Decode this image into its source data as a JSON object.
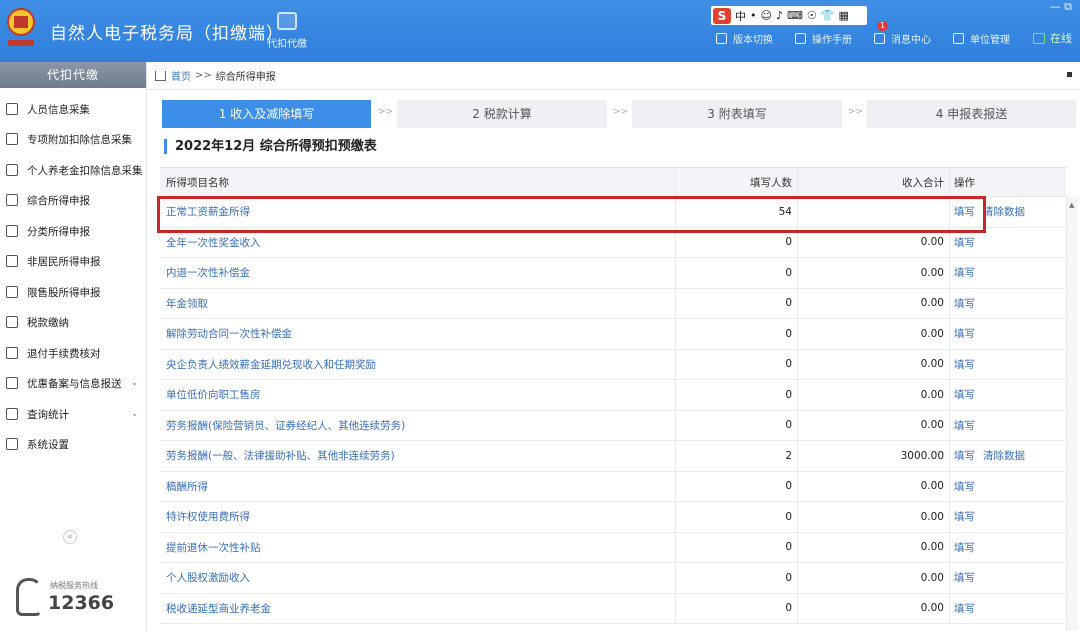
{
  "header": {
    "title": "自然人电子税务局（扣缴端）",
    "proxy_label": "代扣代缴",
    "ime_chars": [
      "中",
      "•",
      "☺",
      "♪",
      "⌨",
      "☉",
      "👕",
      "▦"
    ],
    "ime_brand": "S",
    "actions": [
      {
        "icon": "version-switch-icon",
        "label": "版本切换"
      },
      {
        "icon": "manual-icon",
        "label": "操作手册"
      },
      {
        "icon": "message-center-icon",
        "label": "消息中心",
        "badge": "1"
      },
      {
        "icon": "unit-management-icon",
        "label": "单位管理"
      }
    ],
    "online_label": "在线",
    "window_controls": "— ⧉"
  },
  "sidebar": {
    "title": "代扣代缴",
    "items": [
      {
        "icon": "person-icon",
        "label": "人员信息采集"
      },
      {
        "icon": "list-icon",
        "label": "专项附加扣除信息采集"
      },
      {
        "icon": "document-icon",
        "label": "个人养老金扣除信息采集"
      },
      {
        "icon": "layers-icon",
        "label": "综合所得申报"
      },
      {
        "icon": "pie-icon",
        "label": "分类所得申报"
      },
      {
        "icon": "person-outline-icon",
        "label": "非居民所得申报"
      },
      {
        "icon": "bar-chart-icon",
        "label": "限售股所得申报"
      },
      {
        "icon": "folder-icon",
        "label": "税款缴纳"
      },
      {
        "icon": "form-icon",
        "label": "退付手续费核对"
      },
      {
        "icon": "file-icon",
        "label": "优惠备案与信息报送",
        "expandable": true
      },
      {
        "icon": "query-icon",
        "label": "查询统计",
        "expandable": true
      },
      {
        "icon": "gear-icon",
        "label": "系统设置"
      }
    ],
    "collapse_glyph": "«",
    "hotline_label": "纳税服务热线",
    "hotline_number": "12366"
  },
  "breadcrumb": {
    "home": "首页",
    "sep": ">>",
    "current": "综合所得申报"
  },
  "steps": [
    {
      "label": "1 收入及减除填写",
      "active": true
    },
    {
      "label": "2 税款计算",
      "active": false
    },
    {
      "label": "3 附表填写",
      "active": false
    },
    {
      "label": "4 申报表报送",
      "active": false
    }
  ],
  "step_arrow": ">>",
  "form_title": "2022年12月  综合所得预扣预缴表",
  "table": {
    "headers": [
      "所得项目名称",
      "填写人数",
      "收入合计",
      "操作"
    ],
    "rows": [
      {
        "name": "正常工资薪金所得",
        "count": "54",
        "sum": "",
        "ops": [
          "填写",
          "清除数据"
        ]
      },
      {
        "name": "全年一次性奖金收入",
        "count": "0",
        "sum": "0.00",
        "ops": [
          "填写"
        ]
      },
      {
        "name": "内退一次性补偿金",
        "count": "0",
        "sum": "0.00",
        "ops": [
          "填写"
        ]
      },
      {
        "name": "年金领取",
        "count": "0",
        "sum": "0.00",
        "ops": [
          "填写"
        ]
      },
      {
        "name": "解除劳动合同一次性补偿金",
        "count": "0",
        "sum": "0.00",
        "ops": [
          "填写"
        ]
      },
      {
        "name": "央企负责人绩效薪金延期兑现收入和任期奖励",
        "count": "0",
        "sum": "0.00",
        "ops": [
          "填写"
        ]
      },
      {
        "name": "单位低价向职工售房",
        "count": "0",
        "sum": "0.00",
        "ops": [
          "填写"
        ]
      },
      {
        "name": "劳务报酬(保险营销员、证券经纪人、其他连续劳务)",
        "count": "0",
        "sum": "0.00",
        "ops": [
          "填写"
        ]
      },
      {
        "name": "劳务报酬(一般、法律援助补贴、其他非连续劳务)",
        "count": "2",
        "sum": "3000.00",
        "ops": [
          "填写",
          "清除数据"
        ]
      },
      {
        "name": "稿酬所得",
        "count": "0",
        "sum": "0.00",
        "ops": [
          "填写"
        ]
      },
      {
        "name": "特许权使用费所得",
        "count": "0",
        "sum": "0.00",
        "ops": [
          "填写"
        ]
      },
      {
        "name": "提前退休一次性补贴",
        "count": "0",
        "sum": "0.00",
        "ops": [
          "填写"
        ]
      },
      {
        "name": "个人股权激励收入",
        "count": "0",
        "sum": "0.00",
        "ops": [
          "填写"
        ]
      },
      {
        "name": "税收递延型商业养老金",
        "count": "0",
        "sum": "0.00",
        "ops": [
          "填写"
        ]
      }
    ]
  },
  "colors": {
    "header_bg": "#3586e2",
    "accent": "#3d8ee8",
    "link": "#3a6fb8",
    "highlight": "#c8262b"
  }
}
